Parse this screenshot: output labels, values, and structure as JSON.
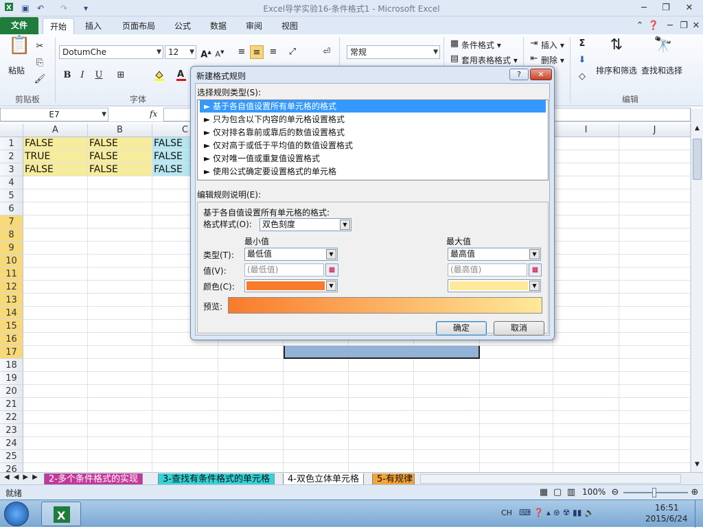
{
  "window": {
    "title": "Excel导学实验16-条件格式1 - Microsoft Excel",
    "quick_access": [
      "save-icon",
      "undo-icon",
      "redo-icon",
      "customize-icon"
    ]
  },
  "ribbon": {
    "tabs": [
      "文件",
      "开始",
      "插入",
      "页面布局",
      "公式",
      "数据",
      "审阅",
      "视图"
    ],
    "active_tab": "开始",
    "clipboard": {
      "paste": "粘贴",
      "group": "剪贴板"
    },
    "font": {
      "name": "DotumChe",
      "size": "12",
      "bold": "B",
      "italic": "I",
      "underline": "U",
      "group": "字体"
    },
    "number": {
      "format": "常规"
    },
    "styles": {
      "conditional": "条件格式",
      "table": "套用表格格式"
    },
    "cells": {
      "insert": "插入",
      "delete": "删除"
    },
    "editing": {
      "sum": "Σ",
      "sort": "排序和筛选",
      "find": "查找和选择",
      "group": "编辑"
    },
    "accent_colors": {
      "file_tab": "#1f7c3c",
      "highlight": "#f7d97a"
    }
  },
  "formula_bar": {
    "name_box": "E7",
    "fx": "fx",
    "content": ""
  },
  "grid": {
    "columns": [
      "A",
      "B",
      "C",
      "I",
      "J"
    ],
    "rows": [
      "1",
      "2",
      "3",
      "4",
      "5",
      "6",
      "7",
      "8",
      "9",
      "10",
      "11",
      "12",
      "13",
      "14",
      "15",
      "16",
      "17",
      "18",
      "19",
      "20",
      "21",
      "22",
      "23",
      "24",
      "25",
      "26"
    ],
    "cells": [
      [
        "FALSE",
        "FALSE",
        "FALSE"
      ],
      [
        "TRUE",
        "FALSE",
        "FALSE"
      ],
      [
        "FALSE",
        "FALSE",
        "FALSE"
      ]
    ]
  },
  "sheet_tabs": [
    "2-多个条件格式的实现",
    "3-查找有条件格式的单元格",
    "4-双色立体单元格",
    "5-有规律"
  ],
  "status": {
    "ready": "就绪",
    "zoom": "100%"
  },
  "taskbar": {
    "ime": "CH",
    "time": "16:51",
    "date": "2015/6/24"
  },
  "dialog": {
    "title": "新建格式规则",
    "select_type_label": "选择规则类型(S):",
    "rule_types": [
      "► 基于各自值设置所有单元格的格式",
      "► 只为包含以下内容的单元格设置格式",
      "► 仅对排名靠前或靠后的数值设置格式",
      "► 仅对高于或低于平均值的数值设置格式",
      "► 仅对唯一值或重复值设置格式",
      "► 使用公式确定要设置格式的单元格"
    ],
    "edit_desc_label": "编辑规则说明(E):",
    "desc_title": "基于各自值设置所有单元格的格式:",
    "format_style_label": "格式样式(O):",
    "format_style_value": "双色刻度",
    "min_header": "最小值",
    "max_header": "最大值",
    "type_label": "类型(T):",
    "value_label": "值(V):",
    "color_label": "颜色(C):",
    "min_type": "最低值",
    "max_type": "最高值",
    "min_value_placeholder": "(最低值)",
    "max_value_placeholder": "(最高值)",
    "min_color": "#f97b2c",
    "max_color": "#ffe99a",
    "preview_label": "预览:",
    "ok": "确定",
    "cancel": "取消",
    "help": "?",
    "close": "✕"
  }
}
